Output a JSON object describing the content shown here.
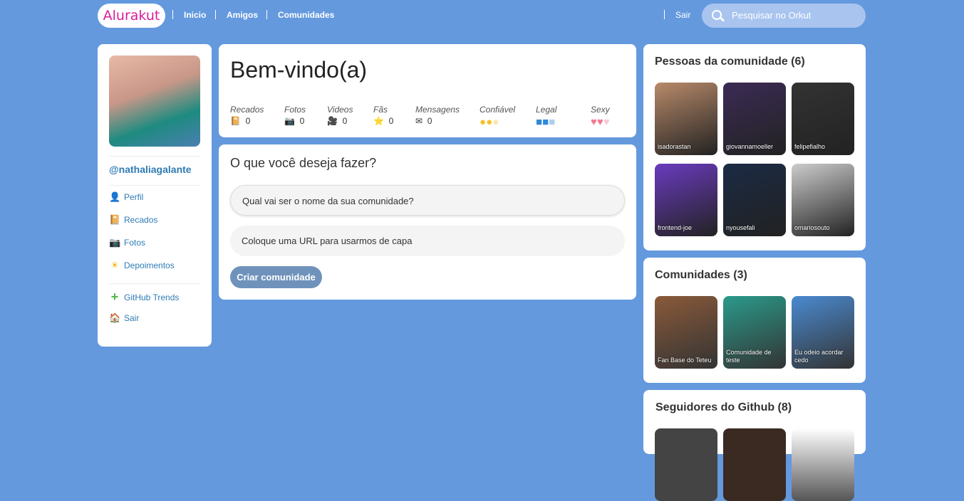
{
  "header": {
    "logo": "Alurakut",
    "nav": [
      "Inicio",
      "Amigos",
      "Comunidades"
    ],
    "logout": "Sair",
    "search_placeholder": "Pesquisar no Orkut"
  },
  "sidebar": {
    "username": "@nathaliagalante",
    "items": [
      {
        "label": "Perfil",
        "icon": "user-icon"
      },
      {
        "label": "Recados",
        "icon": "book-icon"
      },
      {
        "label": "Fotos",
        "icon": "camera-icon"
      },
      {
        "label": "Depoimentos",
        "icon": "sun-icon"
      }
    ],
    "extra": [
      {
        "label": "GitHub Trends",
        "icon": "plus-icon"
      },
      {
        "label": "Sair",
        "icon": "house-icon"
      }
    ]
  },
  "welcome": {
    "title": "Bem-vindo(a)",
    "stats": [
      {
        "label": "Recados",
        "value": "0",
        "icon": "book-icon",
        "glyph": "📔"
      },
      {
        "label": "Fotos",
        "value": "0",
        "icon": "camera-icon",
        "glyph": "📷"
      },
      {
        "label": "Videos",
        "value": "0",
        "icon": "video-camera-icon",
        "glyph": "🎥"
      },
      {
        "label": "Fãs",
        "value": "0",
        "icon": "star-icon",
        "glyph": "⭐"
      },
      {
        "label": "Mensagens",
        "value": "0",
        "icon": "envelope-icon",
        "glyph": "✉"
      }
    ],
    "ratings": [
      {
        "label": "Confiável",
        "level": 2,
        "max": 3,
        "icon": "smiley-icon",
        "color": "#f5c22b"
      },
      {
        "label": "Legal",
        "level": 2,
        "max": 3,
        "icon": "cube-icon",
        "color": "#2c8ad8"
      },
      {
        "label": "Sexy",
        "level": 2,
        "max": 3,
        "icon": "heart-icon",
        "color": "#f07a92"
      }
    ]
  },
  "form": {
    "title": "O que você deseja fazer?",
    "name_placeholder": "Qual vai ser o nome da sua comunidade?",
    "url_placeholder": "Coloque uma URL para usarmos de capa",
    "submit": "Criar comunidade"
  },
  "people": {
    "title": "Pessoas da comunidade (6)",
    "items": [
      "isadorastan",
      "giovannamoeller",
      "felipefialho",
      "frontend-joe",
      "nyousefali",
      "omariosouto"
    ]
  },
  "communities": {
    "title": "Comunidades (3)",
    "items": [
      "Fan Base do Teteu",
      "Comunidade de teste",
      "Eu odeio acordar cedo"
    ]
  },
  "followers": {
    "title": "Seguidores do Github (8)"
  }
}
